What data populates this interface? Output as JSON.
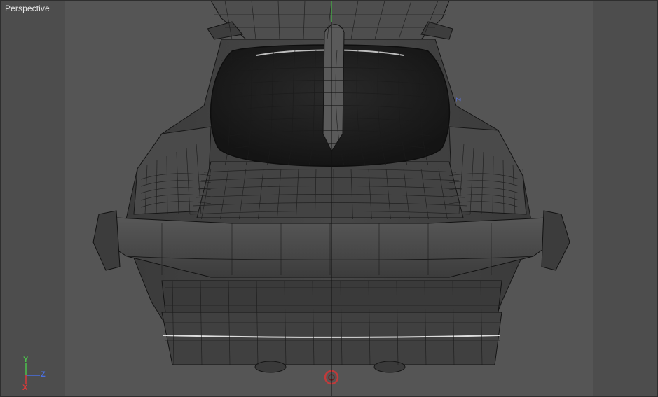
{
  "viewport": {
    "label": "Perspective",
    "view": "perspective",
    "background": "#555555"
  },
  "gizmo": {
    "x_label": "X",
    "y_label": "Y",
    "z_label": "Z",
    "x_color": "#d93a3a",
    "y_color": "#4cc24c",
    "z_color": "#4a6fe0"
  },
  "scene": {
    "object": "car-wireframe-rear-view",
    "shading": "wireframe-on-shaded",
    "wire_color": "#151515",
    "z_marker": "Z"
  }
}
